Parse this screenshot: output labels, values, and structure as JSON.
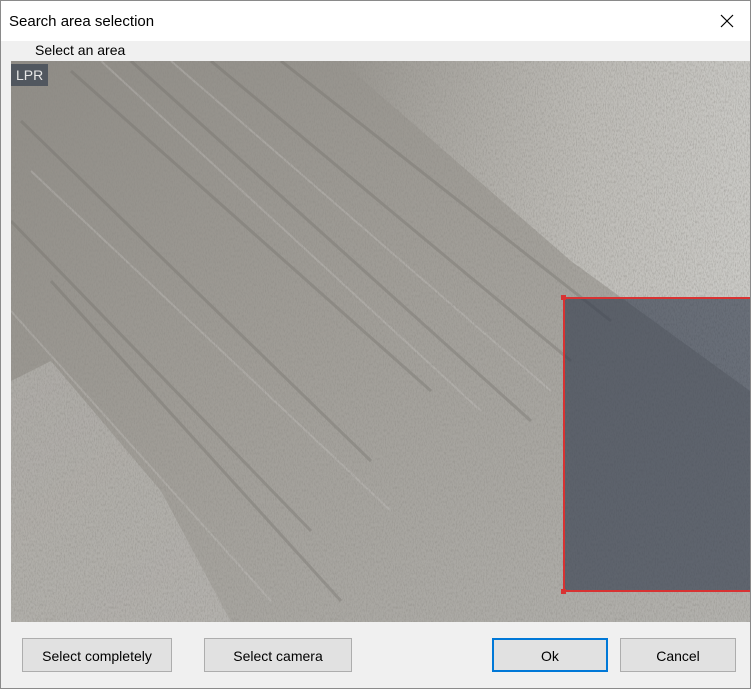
{
  "window": {
    "title": "Search area selection",
    "close_glyph": "✕",
    "subtitle": "Select an area"
  },
  "video": {
    "camera_label": "LPR",
    "scene_description_icon": "camera-frame",
    "selection_color": "#d83232"
  },
  "buttons": {
    "select_completely": "Select completely",
    "select_camera": "Select camera",
    "ok": "Ok",
    "cancel": "Cancel"
  }
}
